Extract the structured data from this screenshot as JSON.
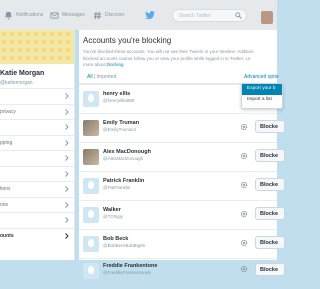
{
  "colors": {
    "accent": "#0084b4",
    "background": "#c0deed",
    "highlight": "#0084b4"
  },
  "topbar": {
    "notifications": "Notifications",
    "messages": "Messages",
    "discover": "Discover",
    "search_placeholder": "Search Twitter"
  },
  "profile": {
    "name": "Katie Morgan",
    "handle": "@katiemorgan"
  },
  "menu": [
    {
      "label": ""
    },
    {
      "label": "privacy"
    },
    {
      "label": ""
    },
    {
      "label": "pping"
    },
    {
      "label": ""
    },
    {
      "label": ""
    },
    {
      "label": "tions"
    },
    {
      "label": "ons"
    },
    {
      "label": ""
    },
    {
      "label": "ounts"
    }
  ],
  "panel": {
    "title": "Accounts you're blocking",
    "desc1": "You've blocked these accounts. You will not see their Tweets in your timeline. Addition",
    "desc2": "blocked accounts cannot follow you or view your profile while logged in to Twitter. Le",
    "desc3_prefix": "more about ",
    "desc3_link": "blocking",
    "filter_all": "All",
    "filter_sep": " | ",
    "filter_imported": "Imported",
    "advanced": "Advanced optio",
    "dropdown": {
      "export": "Export your b",
      "import": "Import a list"
    },
    "block_label": "Blocke",
    "users": [
      {
        "name": "henry ellis",
        "handle": "@henryellis888"
      },
      {
        "name": "Emily Truman",
        "handle": "@EmilyTruman1"
      },
      {
        "name": "Alex MacDonough",
        "handle": "@AlexMacDonough"
      },
      {
        "name": "Patrick Franklin",
        "handle": "@PatFranklin"
      },
      {
        "name": "Walker",
        "handle": "@TGRgiy"
      },
      {
        "name": "Bob Beck",
        "handle": "@BobBeckBobBigMi"
      },
      {
        "name": "Freddie Frankentone",
        "handle": "@FreddieFrankentone9"
      }
    ]
  }
}
